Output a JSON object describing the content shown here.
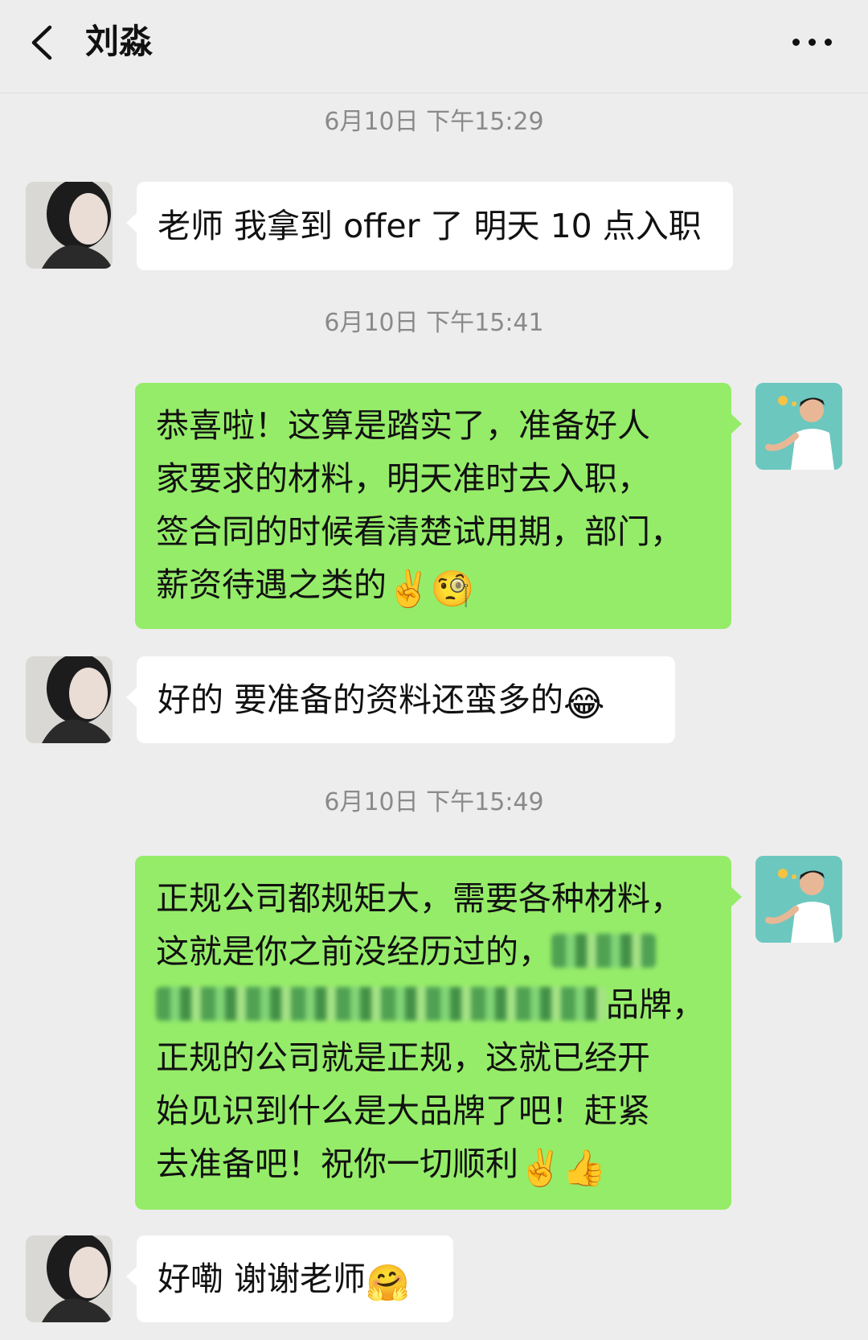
{
  "header": {
    "title": "刘淼",
    "back_icon": "chevron-left-icon",
    "more_icon": "ellipsis-icon"
  },
  "messages": [
    {
      "type": "timestamp",
      "text": "6月10日 下午15:29"
    },
    {
      "type": "incoming",
      "text": "老师 我拿到 offer 了 明天 10 点入职"
    },
    {
      "type": "timestamp",
      "text": "6月10日 下午15:41"
    },
    {
      "type": "outgoing",
      "lines": [
        "恭喜啦！这算是踏实了，准备好人",
        "家要求的材料，明天准时去入职，",
        "签合同的时候看清楚试用期，部门，",
        "薪资待遇之类的"
      ],
      "emojis": [
        "✌️",
        "🧐"
      ]
    },
    {
      "type": "incoming",
      "text": "好的 要准备的资料还蛮多的",
      "emoji": "😂"
    },
    {
      "type": "timestamp",
      "text": "6月10日 下午15:49"
    },
    {
      "type": "outgoing",
      "lines": [
        "正规公司都规矩大，需要各种材料，",
        "这就是你之前没经历过的，",
        "品牌，",
        "正规的公司就是正规，这就已经开",
        "始见识到什么是大品牌了吧！赶紧",
        "去准备吧！祝你一切顺利"
      ],
      "emojis": [
        "✌️",
        "👍"
      ]
    },
    {
      "type": "incoming",
      "text": "好嘞 谢谢老师",
      "emoji": "🤗"
    }
  ],
  "colors": {
    "background": "#ededed",
    "incoming_bubble": "#ffffff",
    "outgoing_bubble": "#95ec69",
    "timestamp_text": "#8a8a8a"
  }
}
